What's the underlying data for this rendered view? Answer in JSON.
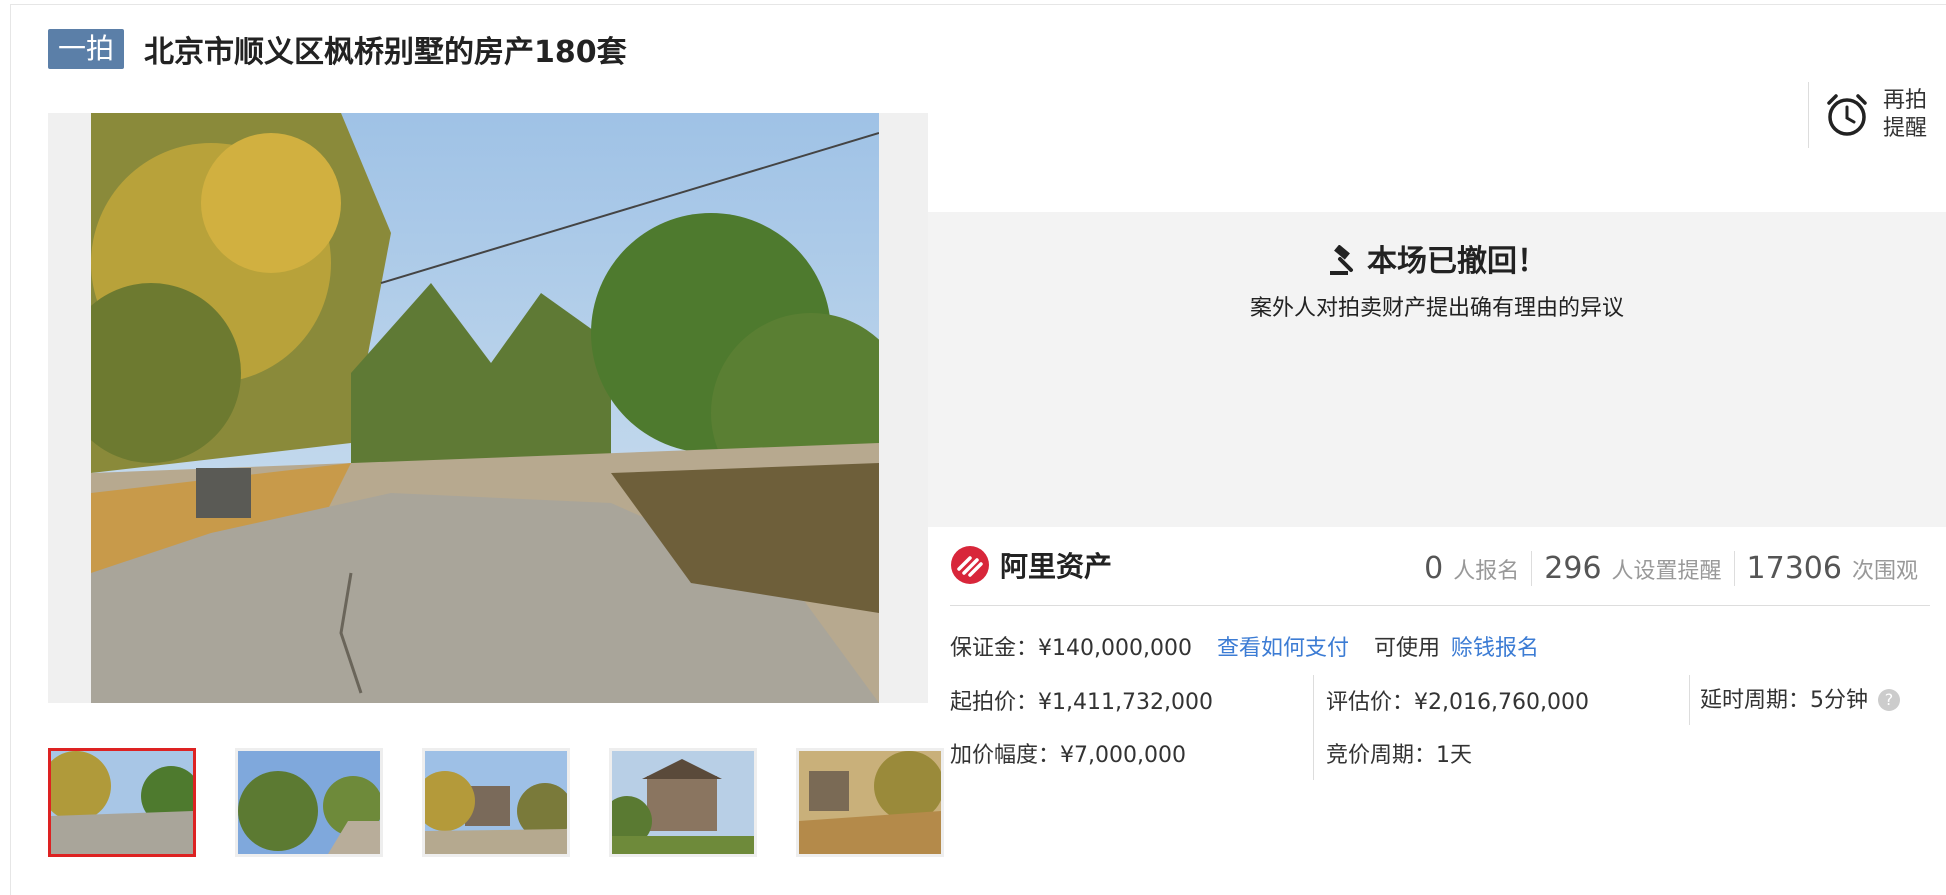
{
  "header": {
    "tag": "一拍",
    "title": "北京市顺义区枫桥别墅的房产180套"
  },
  "remind": {
    "label_line1": "再拍",
    "label_line2": "提醒",
    "icon": "alarm-clock-icon"
  },
  "status": {
    "headline": "本场已撤回！",
    "reason": "案外人对拍卖财产提出确有理由的异议",
    "icon": "gavel-icon"
  },
  "brand": {
    "name": "阿里资产",
    "color": "#d8263a"
  },
  "stats": [
    {
      "num": "0",
      "label": "人报名"
    },
    {
      "num": "296",
      "label": "人设置提醒"
    },
    {
      "num": "17306",
      "label": "次围观"
    }
  ],
  "deposit": {
    "label": "保证金：¥140,000,000",
    "pay_link": "查看如何支付",
    "usable": "可使用",
    "earn_link": "赊钱报名"
  },
  "prices": {
    "start": "起拍价：¥1,411,732,000",
    "appraisal": "评估价：¥2,016,760,000",
    "delay": "延时周期：5分钟",
    "increment": "加价幅度：¥7,000,000",
    "cycle": "竞价周期：1天"
  },
  "colors": {
    "accent_blue": "#3c7cd4",
    "tag_bg": "#5b7fa8",
    "active_thumb": "#dd2222"
  }
}
